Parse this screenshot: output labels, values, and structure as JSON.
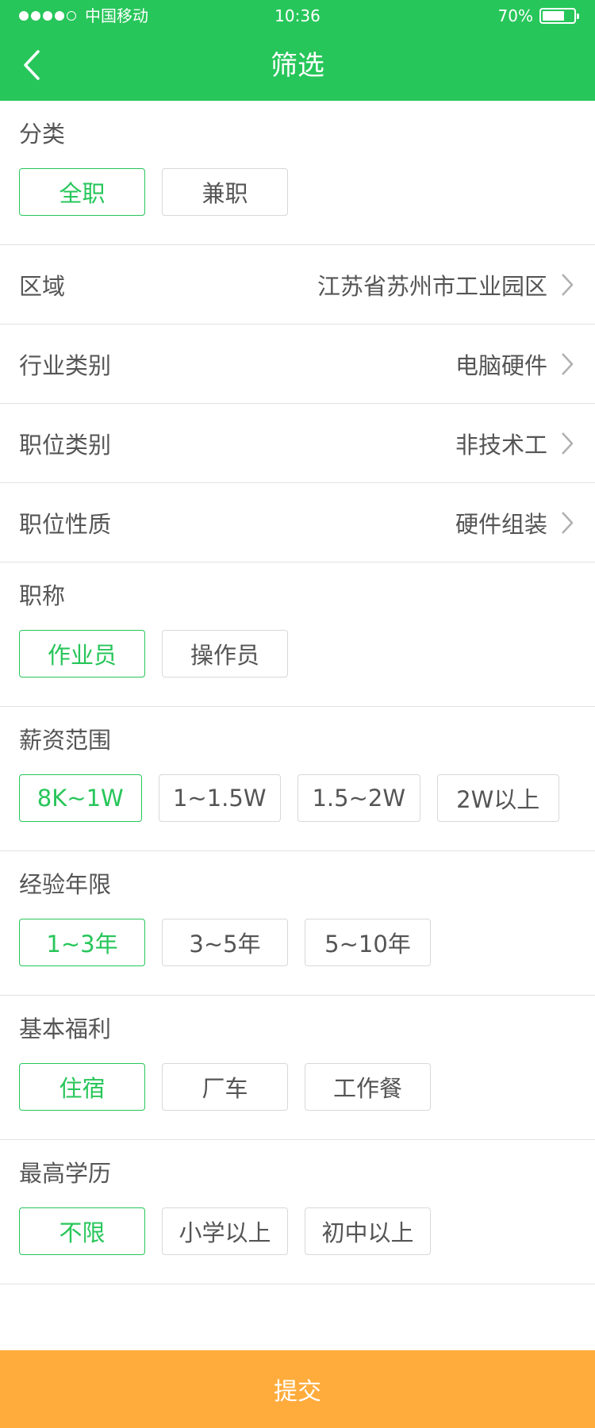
{
  "status_bar": {
    "carrier": "中国移动",
    "time": "10:36",
    "battery": "70%",
    "battery_level": 0.7,
    "signal_bars": 4,
    "signal_total": 5
  },
  "nav": {
    "title": "筛选"
  },
  "category": {
    "title": "分类",
    "options": [
      "全职",
      "兼职"
    ],
    "selected": 0
  },
  "region": {
    "label": "区域",
    "value": "江苏省苏州市工业园区"
  },
  "industry": {
    "label": "行业类别",
    "value": "电脑硬件"
  },
  "position_type": {
    "label": "职位类别",
    "value": "非技术工"
  },
  "position_nature": {
    "label": "职位性质",
    "value": "硬件组装"
  },
  "job_title": {
    "title": "职称",
    "options": [
      "作业员",
      "操作员"
    ],
    "selected": 0
  },
  "salary": {
    "title": "薪资范围",
    "options": [
      "8K~1W",
      "1~1.5W",
      "1.5~2W",
      "2W以上"
    ],
    "selected": 0
  },
  "experience": {
    "title": "经验年限",
    "options": [
      "1~3年",
      "3~5年",
      "5~10年"
    ],
    "selected": 0
  },
  "benefits": {
    "title": "基本福利",
    "options": [
      "住宿",
      "厂车",
      "工作餐"
    ],
    "selected": 0
  },
  "education": {
    "title": "最高学历",
    "options": [
      "不限",
      "小学以上",
      "初中以上"
    ],
    "selected": 0
  },
  "submit": {
    "label": "提交"
  },
  "colors": {
    "primary": "#27c65a",
    "submit": "#ffac3d",
    "text": "#555555",
    "border": "#d8d8d8"
  }
}
